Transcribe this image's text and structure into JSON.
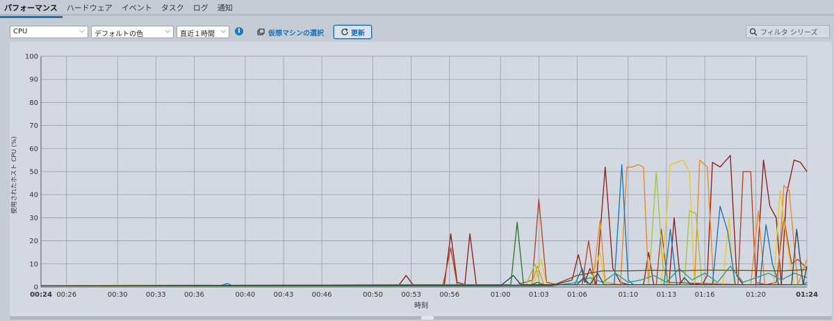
{
  "tabs": [
    {
      "label": "パフォーマンス",
      "active": true
    },
    {
      "label": "ハードウェア",
      "active": false
    },
    {
      "label": "イベント",
      "active": false
    },
    {
      "label": "タスク",
      "active": false
    },
    {
      "label": "ログ",
      "active": false
    },
    {
      "label": "通知",
      "active": false
    }
  ],
  "toolbar": {
    "metric_select": "CPU",
    "color_select": "デフォルトの色",
    "range_select": "直近１時間",
    "vm_select_label": "仮想マシンの選択",
    "refresh_label": "更新",
    "filter_placeholder": "フィルタ シリーズ"
  },
  "colors": {
    "accent": "#1a6db3",
    "chart_background": "#d4d9e1",
    "grid": "#8a93a1"
  },
  "chart_data": {
    "type": "line",
    "ylabel": "使用されたホスト CPU (%)",
    "xlabel": "時刻",
    "ylim": [
      0,
      100
    ],
    "yticks": [
      0,
      10,
      20,
      30,
      40,
      50,
      60,
      70,
      80,
      90,
      100
    ],
    "xlim": [
      0,
      60
    ],
    "xticks": [
      {
        "label": "00:24",
        "t": 0,
        "bold": true
      },
      {
        "label": "00:26",
        "t": 2
      },
      {
        "label": "00:30",
        "t": 6
      },
      {
        "label": "00:33",
        "t": 9
      },
      {
        "label": "00:36",
        "t": 12
      },
      {
        "label": "00:40",
        "t": 16
      },
      {
        "label": "00:43",
        "t": 19
      },
      {
        "label": "00:46",
        "t": 22
      },
      {
        "label": "00:50",
        "t": 26
      },
      {
        "label": "00:53",
        "t": 29
      },
      {
        "label": "00:56",
        "t": 32
      },
      {
        "label": "01:00",
        "t": 36
      },
      {
        "label": "01:03",
        "t": 39
      },
      {
        "label": "01:06",
        "t": 42
      },
      {
        "label": "01:10",
        "t": 46
      },
      {
        "label": "01:13",
        "t": 49
      },
      {
        "label": "01:16",
        "t": 52
      },
      {
        "label": "01:20",
        "t": 56
      },
      {
        "label": "01:24",
        "t": 60,
        "bold": true
      }
    ],
    "grid": true,
    "legend": "none",
    "series": [
      {
        "color": "#8b2323",
        "points": [
          [
            0,
            0.5
          ],
          [
            10,
            0.6
          ],
          [
            28,
            0.5
          ],
          [
            28.6,
            5
          ],
          [
            29.2,
            0.5
          ],
          [
            31.6,
            1
          ],
          [
            32.1,
            23
          ],
          [
            32.6,
            2
          ],
          [
            33.2,
            1
          ],
          [
            33.6,
            23
          ],
          [
            34.1,
            1
          ],
          [
            40,
            0.6
          ],
          [
            41.6,
            3
          ],
          [
            42.1,
            14
          ],
          [
            42.6,
            2
          ],
          [
            43,
            8
          ],
          [
            43.5,
            1
          ],
          [
            44.2,
            52
          ],
          [
            44.8,
            8
          ],
          [
            45.4,
            2
          ],
          [
            46,
            1
          ],
          [
            47.2,
            1
          ],
          [
            47.6,
            15
          ],
          [
            48,
            1
          ],
          [
            49.2,
            1
          ],
          [
            49.6,
            30
          ],
          [
            50.1,
            2
          ],
          [
            51.8,
            1
          ],
          [
            52.2,
            5
          ],
          [
            52.6,
            54
          ],
          [
            53.2,
            52
          ],
          [
            54,
            57
          ],
          [
            54.5,
            5
          ],
          [
            55,
            1
          ],
          [
            56,
            1
          ],
          [
            56.6,
            55
          ],
          [
            57.1,
            35
          ],
          [
            57.6,
            30
          ],
          [
            58,
            1
          ],
          [
            58.4,
            40
          ],
          [
            59,
            55
          ],
          [
            59.5,
            54
          ],
          [
            60,
            50
          ]
        ]
      },
      {
        "color": "#b04a2a",
        "points": [
          [
            0,
            0.5
          ],
          [
            31.5,
            1
          ],
          [
            32.1,
            17
          ],
          [
            32.6,
            1
          ],
          [
            37,
            0.5
          ],
          [
            38.5,
            3
          ],
          [
            39,
            38
          ],
          [
            39.6,
            2
          ],
          [
            40.5,
            1
          ],
          [
            42.4,
            1
          ],
          [
            42.9,
            20
          ],
          [
            43.4,
            1
          ],
          [
            48.2,
            1
          ],
          [
            48.6,
            25
          ],
          [
            49.1,
            2
          ],
          [
            54.6,
            1
          ],
          [
            55,
            50
          ],
          [
            55.6,
            50
          ],
          [
            56,
            2
          ],
          [
            56.8,
            1
          ],
          [
            57.6,
            2
          ],
          [
            58.2,
            30
          ],
          [
            58.8,
            10
          ],
          [
            59.3,
            12
          ],
          [
            60,
            8
          ]
        ]
      },
      {
        "color": "#e8892a",
        "points": [
          [
            0,
            0.5
          ],
          [
            34,
            0.5
          ],
          [
            38.4,
            1
          ],
          [
            38.9,
            9
          ],
          [
            39.4,
            1
          ],
          [
            43.2,
            1
          ],
          [
            43.8,
            29
          ],
          [
            44.2,
            2
          ],
          [
            45.4,
            1
          ],
          [
            45.9,
            52
          ],
          [
            46.3,
            52
          ],
          [
            46.8,
            53
          ],
          [
            47.2,
            52
          ],
          [
            47.6,
            1
          ],
          [
            51.2,
            1
          ],
          [
            51.6,
            55
          ],
          [
            52.2,
            52
          ],
          [
            52.7,
            1
          ],
          [
            53.8,
            1
          ],
          [
            54.2,
            1
          ],
          [
            55.6,
            1
          ],
          [
            56.2,
            33
          ],
          [
            56.7,
            1
          ],
          [
            57.7,
            1
          ],
          [
            58.2,
            44
          ],
          [
            58.6,
            42
          ],
          [
            59.3,
            1
          ],
          [
            60,
            12
          ]
        ]
      },
      {
        "color": "#e8c82a",
        "points": [
          [
            0,
            0.5
          ],
          [
            13,
            1
          ],
          [
            14,
            0.5
          ],
          [
            38.6,
            1
          ],
          [
            39.2,
            12
          ],
          [
            39.6,
            1
          ],
          [
            43,
            1
          ],
          [
            43.8,
            15
          ],
          [
            44.2,
            1
          ],
          [
            48.6,
            1
          ],
          [
            49.3,
            53
          ],
          [
            49.8,
            54
          ],
          [
            50.3,
            55
          ],
          [
            50.8,
            50
          ],
          [
            51.2,
            1
          ],
          [
            53.4,
            1
          ],
          [
            53.9,
            30
          ],
          [
            54.3,
            1
          ],
          [
            57.4,
            1
          ],
          [
            57.9,
            42
          ],
          [
            58.4,
            20
          ],
          [
            59,
            1
          ],
          [
            60,
            1
          ]
        ]
      },
      {
        "color": "#a6c437",
        "points": [
          [
            0,
            0.5
          ],
          [
            38,
            1
          ],
          [
            38.7,
            10
          ],
          [
            39.1,
            1
          ],
          [
            47.6,
            1
          ],
          [
            48.2,
            50
          ],
          [
            48.7,
            10
          ],
          [
            49.2,
            1
          ],
          [
            50.4,
            1
          ],
          [
            50.8,
            33
          ],
          [
            51.3,
            32
          ],
          [
            51.8,
            1
          ],
          [
            60,
            1
          ]
        ]
      },
      {
        "color": "#1f77b4",
        "points": [
          [
            0,
            0.5
          ],
          [
            14,
            0.5
          ],
          [
            14.6,
            1.5
          ],
          [
            15,
            0.5
          ],
          [
            32,
            0.5
          ],
          [
            41.8,
            1
          ],
          [
            42.4,
            8
          ],
          [
            42.8,
            1
          ],
          [
            44.9,
            1
          ],
          [
            45.5,
            53
          ],
          [
            46,
            3
          ],
          [
            46.4,
            1
          ],
          [
            48.8,
            1
          ],
          [
            49.3,
            25
          ],
          [
            49.8,
            1
          ],
          [
            52.6,
            1
          ],
          [
            53.2,
            35
          ],
          [
            53.8,
            24
          ],
          [
            54.4,
            1
          ],
          [
            56.3,
            1
          ],
          [
            56.8,
            27
          ],
          [
            57.3,
            10
          ],
          [
            57.8,
            1
          ],
          [
            59.6,
            1
          ],
          [
            60,
            2
          ]
        ]
      },
      {
        "color": "#2ca08a",
        "points": [
          [
            0,
            0.5
          ],
          [
            40,
            0.5
          ],
          [
            42,
            2
          ],
          [
            43,
            4
          ],
          [
            44,
            2
          ],
          [
            45,
            6
          ],
          [
            46,
            2
          ],
          [
            47,
            3
          ],
          [
            48,
            5
          ],
          [
            49,
            2
          ],
          [
            50,
            8
          ],
          [
            51,
            3
          ],
          [
            52,
            6
          ],
          [
            53,
            2
          ],
          [
            54,
            9
          ],
          [
            55,
            2
          ],
          [
            56,
            4
          ],
          [
            57,
            6
          ],
          [
            58,
            3
          ],
          [
            59,
            6
          ],
          [
            60,
            4
          ]
        ]
      },
      {
        "color": "#2e7d32",
        "points": [
          [
            0,
            0.5
          ],
          [
            36.8,
            1
          ],
          [
            37.3,
            28
          ],
          [
            37.8,
            1
          ],
          [
            38.4,
            1
          ],
          [
            38.9,
            2
          ],
          [
            39.4,
            1
          ],
          [
            60,
            1
          ]
        ]
      },
      {
        "color": "#6b5a1e",
        "points": [
          [
            0,
            0.5
          ],
          [
            40,
            0.5
          ],
          [
            42,
            5
          ],
          [
            44,
            7
          ],
          [
            46,
            7
          ],
          [
            48,
            7.2
          ],
          [
            50,
            7
          ],
          [
            52,
            7.3
          ],
          [
            54,
            7.2
          ],
          [
            56,
            7.1
          ],
          [
            58,
            7
          ],
          [
            60,
            7.5
          ]
        ]
      },
      {
        "color": "#34495e",
        "points": [
          [
            0,
            0.5
          ],
          [
            36,
            0.5
          ],
          [
            37,
            5
          ],
          [
            37.6,
            1
          ],
          [
            42,
            1
          ],
          [
            42.5,
            4
          ],
          [
            43,
            1
          ],
          [
            43.6,
            6
          ],
          [
            44.1,
            1
          ],
          [
            50,
            1
          ],
          [
            50.4,
            4
          ],
          [
            50.9,
            1
          ],
          [
            58.8,
            1
          ],
          [
            59.2,
            25
          ],
          [
            59.7,
            1
          ],
          [
            60,
            9
          ]
        ]
      }
    ]
  }
}
